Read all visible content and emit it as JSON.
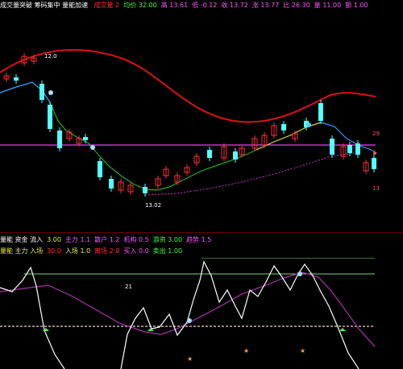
{
  "header": {
    "title": "成交量突破 筹码集中 量能加速",
    "indicators": [
      {
        "label": "成交量",
        "value": "2",
        "color": "#ff3030"
      },
      {
        "label": "均价",
        "value": "32.00",
        "color": "#44ff44"
      },
      {
        "label": "高",
        "value": "13.61",
        "color": "#ff55ff"
      },
      {
        "label": "低",
        "value": "-0.12",
        "color": "#ff55ff"
      },
      {
        "label": "收",
        "value": "13.72",
        "color": "#ff55ff"
      },
      {
        "label": "涨",
        "value": "13.77",
        "color": "#ff55ff"
      },
      {
        "label": "比",
        "value": "26.30",
        "color": "#ff55ff"
      },
      {
        "label": "量",
        "value": "11.00",
        "color": "#ff55ff"
      },
      {
        "label": "额",
        "value": "1.00",
        "color": "#ff55ff"
      }
    ]
  },
  "price_chart": {
    "high_label": "12.0",
    "low_label": "13.02",
    "right_labels": [
      "29",
      "13",
      "8"
    ]
  },
  "lower_header": {
    "line1": [
      {
        "text": "量能 资金 流入",
        "color": "#ffffff"
      },
      {
        "text": "3.00",
        "color": "#e8e84a"
      },
      {
        "text": "主力 1.1",
        "color": "#ff55ff"
      },
      {
        "text": "散户 1.2",
        "color": "#ff55ff"
      },
      {
        "text": "机构 0.5",
        "color": "#ff55ff"
      },
      {
        "text": "游资 3.00",
        "color": "#44ff44"
      },
      {
        "text": "趋势 1.5",
        "color": "#ff55ff"
      }
    ],
    "line2": [
      {
        "text": "量能 主力 入场",
        "color": "#e8e84a"
      },
      {
        "text": "30.0",
        "color": "#ff3030"
      },
      {
        "text": "入场 1.0",
        "color": "#e8e84a"
      },
      {
        "text": "离场 2.0",
        "color": "#ff3030"
      },
      {
        "text": "买入 0.0",
        "color": "#ff55ff"
      },
      {
        "text": "卖出 1.00",
        "color": "#44ff44"
      }
    ]
  },
  "indicator_chart": {
    "marker_label": "21"
  },
  "colors": {
    "background": "#000000",
    "ma_red": "#dd1111",
    "ma_green": "#22aa22",
    "ma_blue": "#3399ff",
    "ma_yellow": "#dddd33",
    "ref_magenta": "#cc33cc",
    "candle_up": "#ff3030",
    "candle_down": "#55ffff",
    "guide_line": "#7fd27f",
    "white_line": "#ffffff",
    "purple_line": "#aa33aa"
  }
}
